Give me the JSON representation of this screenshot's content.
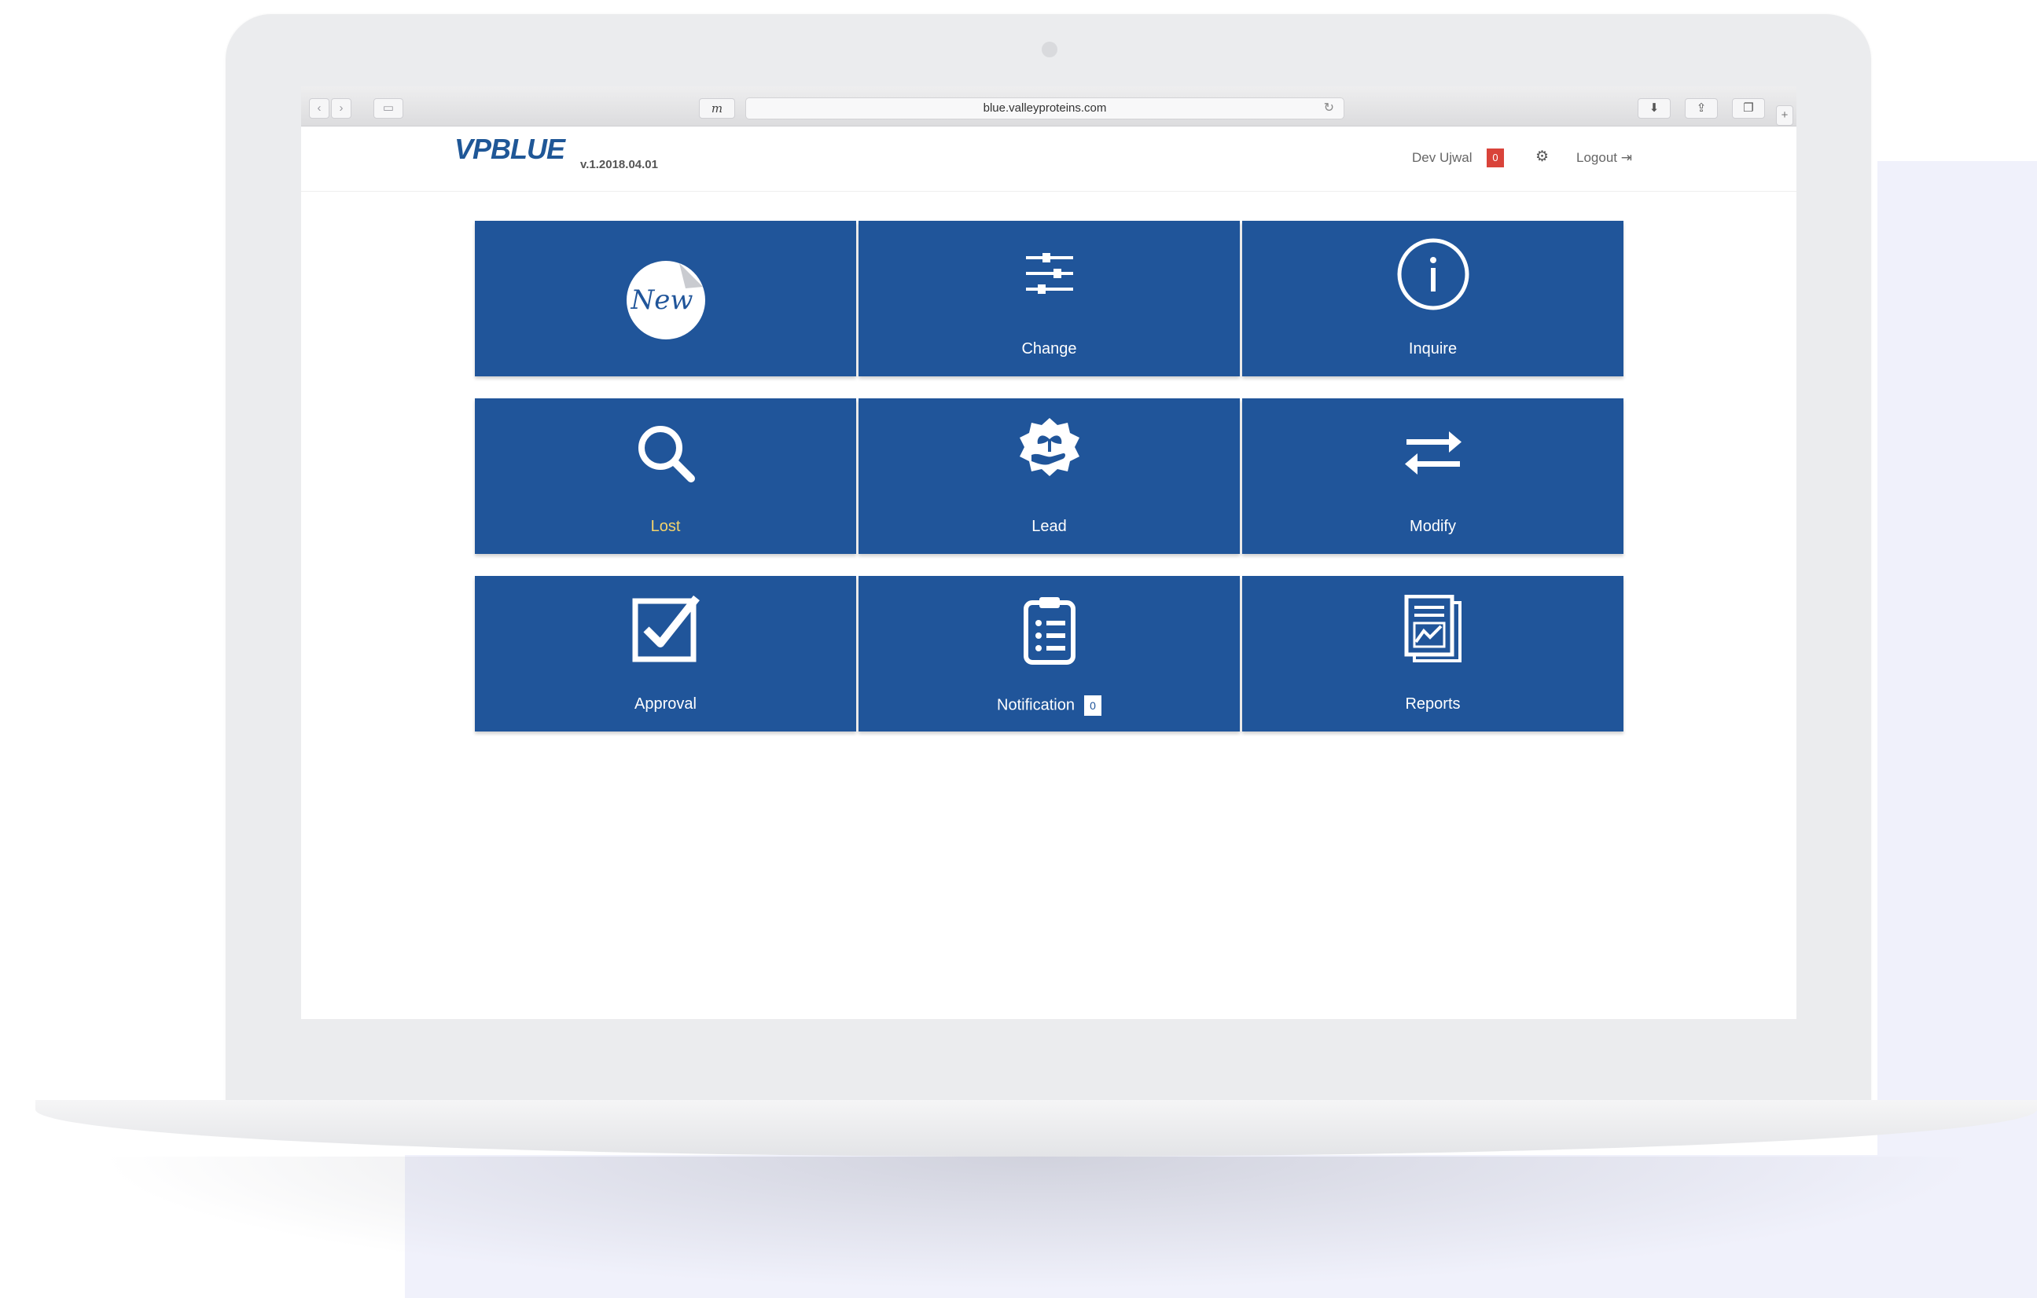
{
  "browser": {
    "url": "blue.valleyproteins.com",
    "reader_label": "m"
  },
  "header": {
    "logo_text": "VPBLUE",
    "version": "v.1.2018.04.01",
    "user_name": "Dev Ujwal",
    "user_badge_count": "0",
    "logout_label": "Logout"
  },
  "tiles": [
    {
      "label": "New",
      "icon": "new-sticker-icon"
    },
    {
      "label": "Change",
      "icon": "sliders-icon"
    },
    {
      "label": "Inquire",
      "icon": "info-icon"
    },
    {
      "label": "Lost",
      "icon": "search-icon"
    },
    {
      "label": "Lead",
      "icon": "plant-hand-icon"
    },
    {
      "label": "Modify",
      "icon": "swap-arrows-icon"
    },
    {
      "label": "Approval",
      "icon": "checkbox-icon"
    },
    {
      "label": "Notification",
      "icon": "clipboard-list-icon",
      "badge": "0"
    },
    {
      "label": "Reports",
      "icon": "report-chart-icon"
    }
  ],
  "colors": {
    "tile_blue": "#20559a",
    "lost_label": "#f3d36b",
    "badge_red": "#d9433a"
  }
}
